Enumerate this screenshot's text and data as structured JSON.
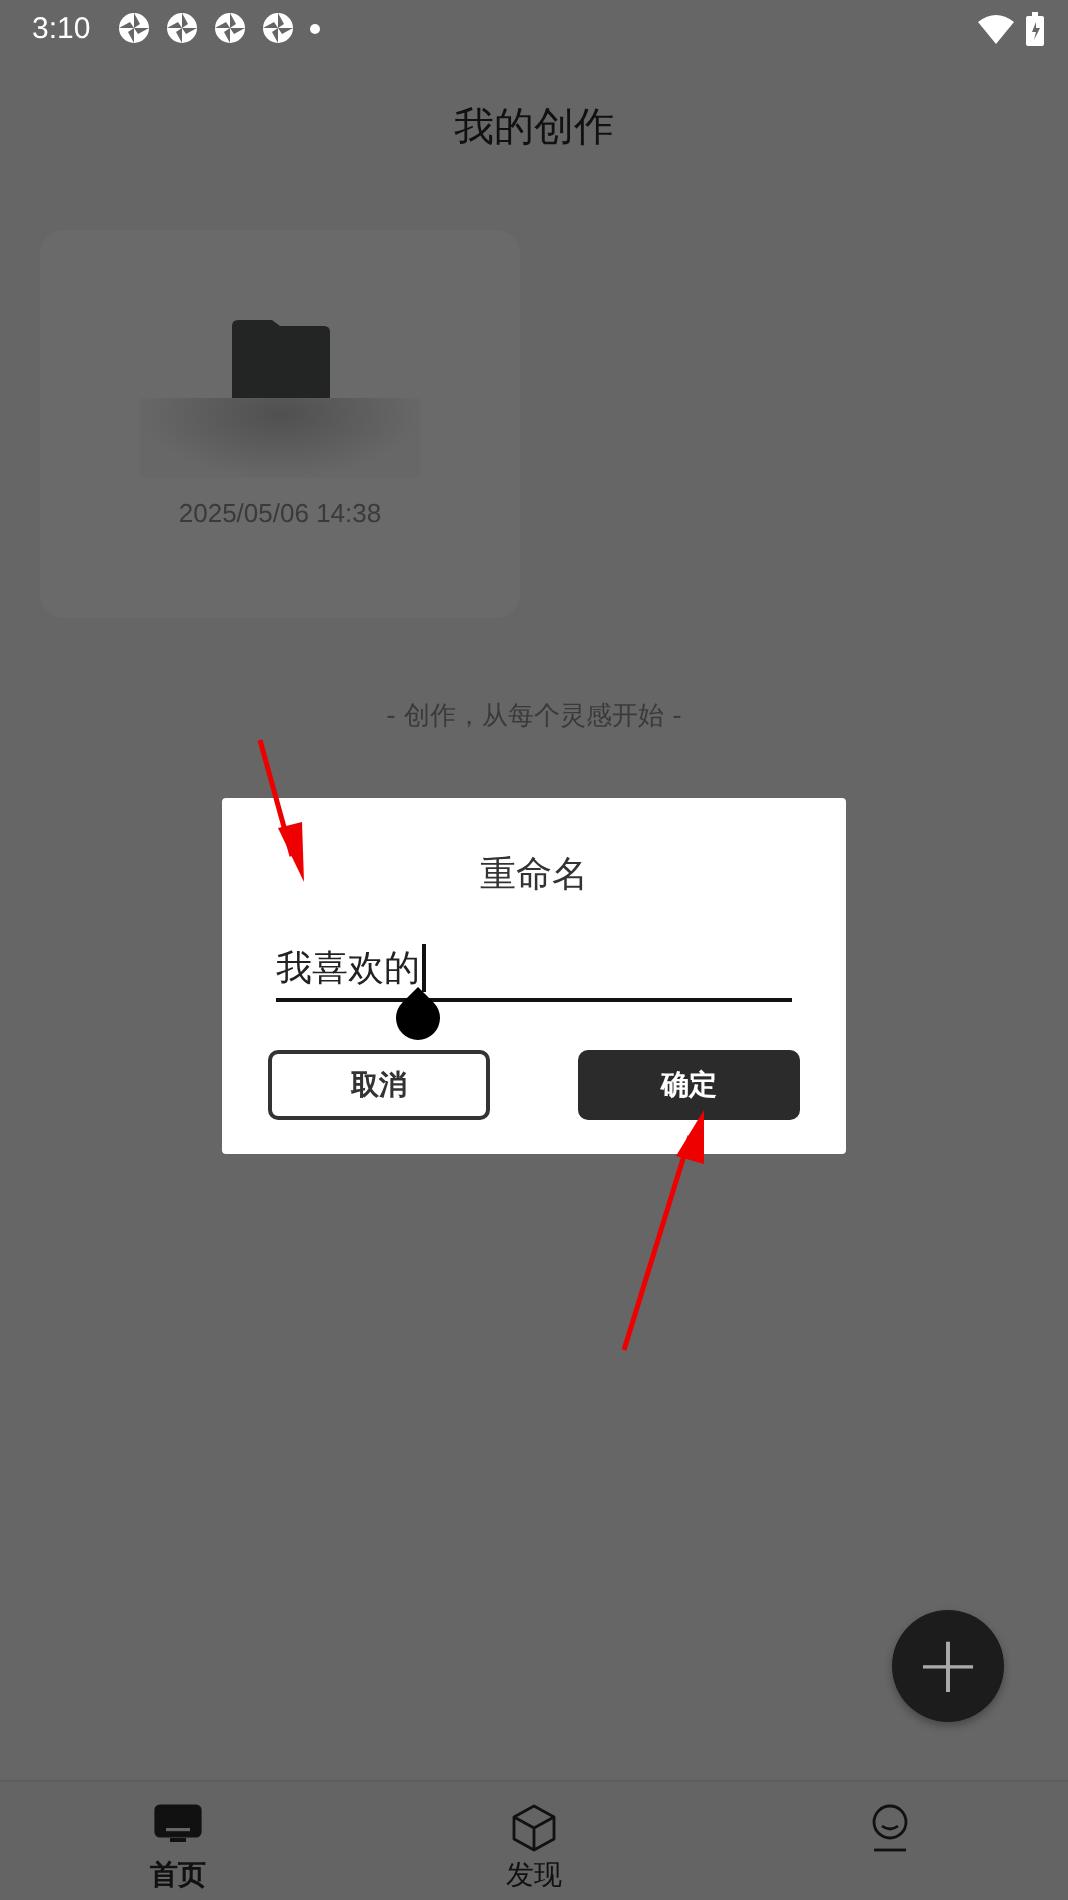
{
  "status_bar": {
    "time": "3:10"
  },
  "header": {
    "title": "我的创作"
  },
  "works": [
    {
      "date": "2025/05/06 14:38"
    }
  ],
  "tagline": "- 创作，从每个灵感开始 -",
  "dialog": {
    "title": "重命名",
    "value": "我喜欢的",
    "buttons": [
      {
        "label": "取消",
        "kind": "secondary"
      },
      {
        "label": "确定",
        "kind": "primary"
      }
    ]
  },
  "fab": {
    "label": "+"
  },
  "tabs": [
    {
      "label": "首页",
      "kind": "home",
      "selected": true
    },
    {
      "label": "发现",
      "kind": "discover",
      "selected": false
    },
    {
      "kind": "profile",
      "selected": false
    }
  ]
}
